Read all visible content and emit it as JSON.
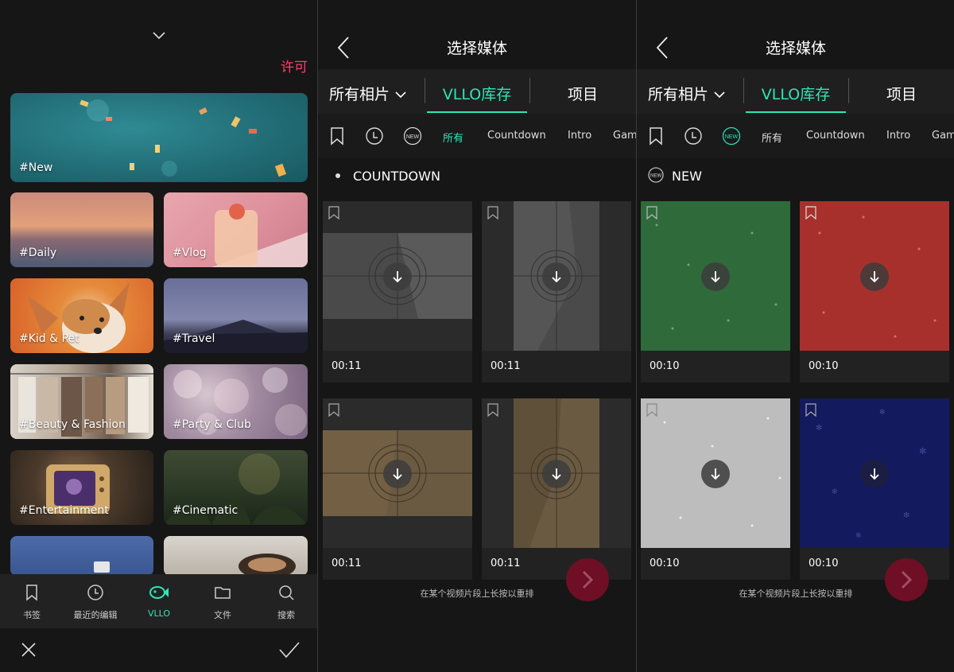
{
  "colors": {
    "accent": "#2fe6b7",
    "allow": "#ff3d6b",
    "next": "#6e0f25"
  },
  "panel1": {
    "allow_label": "许可",
    "tiles": [
      "#New",
      "#Daily",
      "#Vlog",
      "#Kid & Pet",
      "#Travel",
      "#Beauty & Fashion",
      "#Party & Club",
      "#Entertainment",
      "#Cinematic"
    ],
    "nav": [
      {
        "label": "书签",
        "icon": "bookmark-icon"
      },
      {
        "label": "最近的编辑",
        "icon": "history-icon"
      },
      {
        "label": "VLLO",
        "icon": "vllo-fish-icon"
      },
      {
        "label": "文件",
        "icon": "folder-icon"
      },
      {
        "label": "搜索",
        "icon": "search-icon"
      }
    ]
  },
  "panel2": {
    "title": "选择媒体",
    "source_tabs": {
      "all": "所有相片",
      "library": "VLLO库存",
      "project": "项目"
    },
    "categories": [
      "所有",
      "Countdown",
      "Intro",
      "Gam"
    ],
    "new_badge": "NEW",
    "section": "COUNTDOWN",
    "items": [
      {
        "duration": "00:11"
      },
      {
        "duration": "00:11"
      },
      {
        "duration": "00:11"
      },
      {
        "duration": "00:11"
      }
    ],
    "hint": "在某个视频片段上长按以重排"
  },
  "panel3": {
    "title": "选择媒体",
    "source_tabs": {
      "all": "所有相片",
      "library": "VLLO库存",
      "project": "项目"
    },
    "categories": [
      "所有",
      "Countdown",
      "Intro",
      "Gam"
    ],
    "new_badge": "NEW",
    "section": "NEW",
    "items": [
      {
        "duration": "00:10"
      },
      {
        "duration": "00:10"
      },
      {
        "duration": "00:10"
      },
      {
        "duration": "00:10"
      }
    ],
    "hint": "在某个视频片段上长按以重排"
  }
}
